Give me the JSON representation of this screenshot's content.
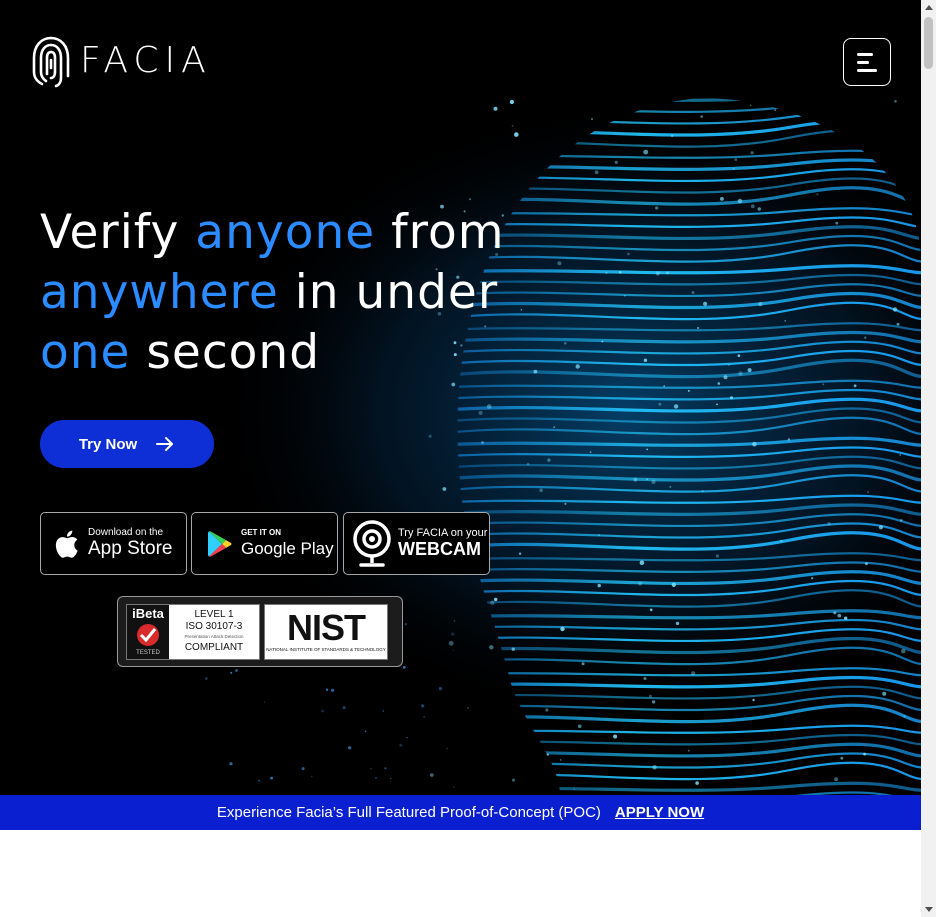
{
  "brand": {
    "name": "FACIA",
    "logo_icon": "fingerprint-icon"
  },
  "nav": {
    "menu_icon": "hamburger-menu-icon"
  },
  "hero": {
    "headline_parts": {
      "l1_white": "Verify",
      "l1_blue": "anyone",
      "l1_white2": "from",
      "l2_blue": "anywhere",
      "l2_white": "in under",
      "l3_blue": "one",
      "l3_white": "second"
    },
    "cta_label": "Try Now",
    "cta_icon": "arrow-right-icon"
  },
  "stores": {
    "app_store": {
      "small": "Download on the",
      "big": "App Store",
      "icon": "apple-icon"
    },
    "google_play": {
      "small": "GET IT ON",
      "big": "Google Play",
      "icon": "google-play-icon"
    },
    "webcam": {
      "small": "Try FACIA on your",
      "big": "WEBCAM",
      "icon": "webcam-icon"
    }
  },
  "certs": {
    "ibeta": {
      "brand": "iBeta",
      "tested": "TESTED",
      "level": "LEVEL 1",
      "iso": "ISO 30107-3",
      "pad": "Presentation Attack Detection",
      "compliant": "COMPLIANT"
    },
    "nist": {
      "logo": "NIST",
      "caption": "NATIONAL INSTITUTE OF STANDARDS & TECHNOLOGY"
    }
  },
  "banner": {
    "text": "Experience Facia’s Full Featured Proof-of-Concept (POC)",
    "link": "APPLY NOW"
  },
  "colors": {
    "accent_blue": "#2a8cff",
    "button_blue": "#0f2fd6",
    "banner_blue": "#0a1fd0",
    "background": "#000000",
    "glow_cyan": "#1ec8ff"
  }
}
